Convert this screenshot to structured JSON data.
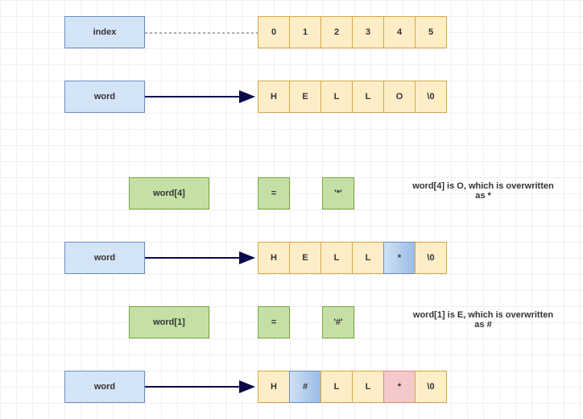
{
  "labels": {
    "index": "index",
    "word": "word"
  },
  "rows": {
    "index_cells": [
      "0",
      "1",
      "2",
      "3",
      "4",
      "5"
    ],
    "word1_cells": [
      "H",
      "E",
      "L",
      "L",
      "O",
      "\\0"
    ],
    "word2_cells": [
      "H",
      "E",
      "L",
      "L",
      "*",
      "\\0"
    ],
    "word3_cells": [
      "H",
      "#",
      "L",
      "L",
      "*",
      "\\0"
    ]
  },
  "expr1": {
    "lhs": "word[4]",
    "eq": "=",
    "rhs": "'*'"
  },
  "expr2": {
    "lhs": "word[1]",
    "eq": "=",
    "rhs": "'#'"
  },
  "annot1_line1": "word[4] is O, which is overwritten",
  "annot1_line2": "as *",
  "annot2_line1": "word[1] is E, which is overwritten",
  "annot2_line2": "as #"
}
